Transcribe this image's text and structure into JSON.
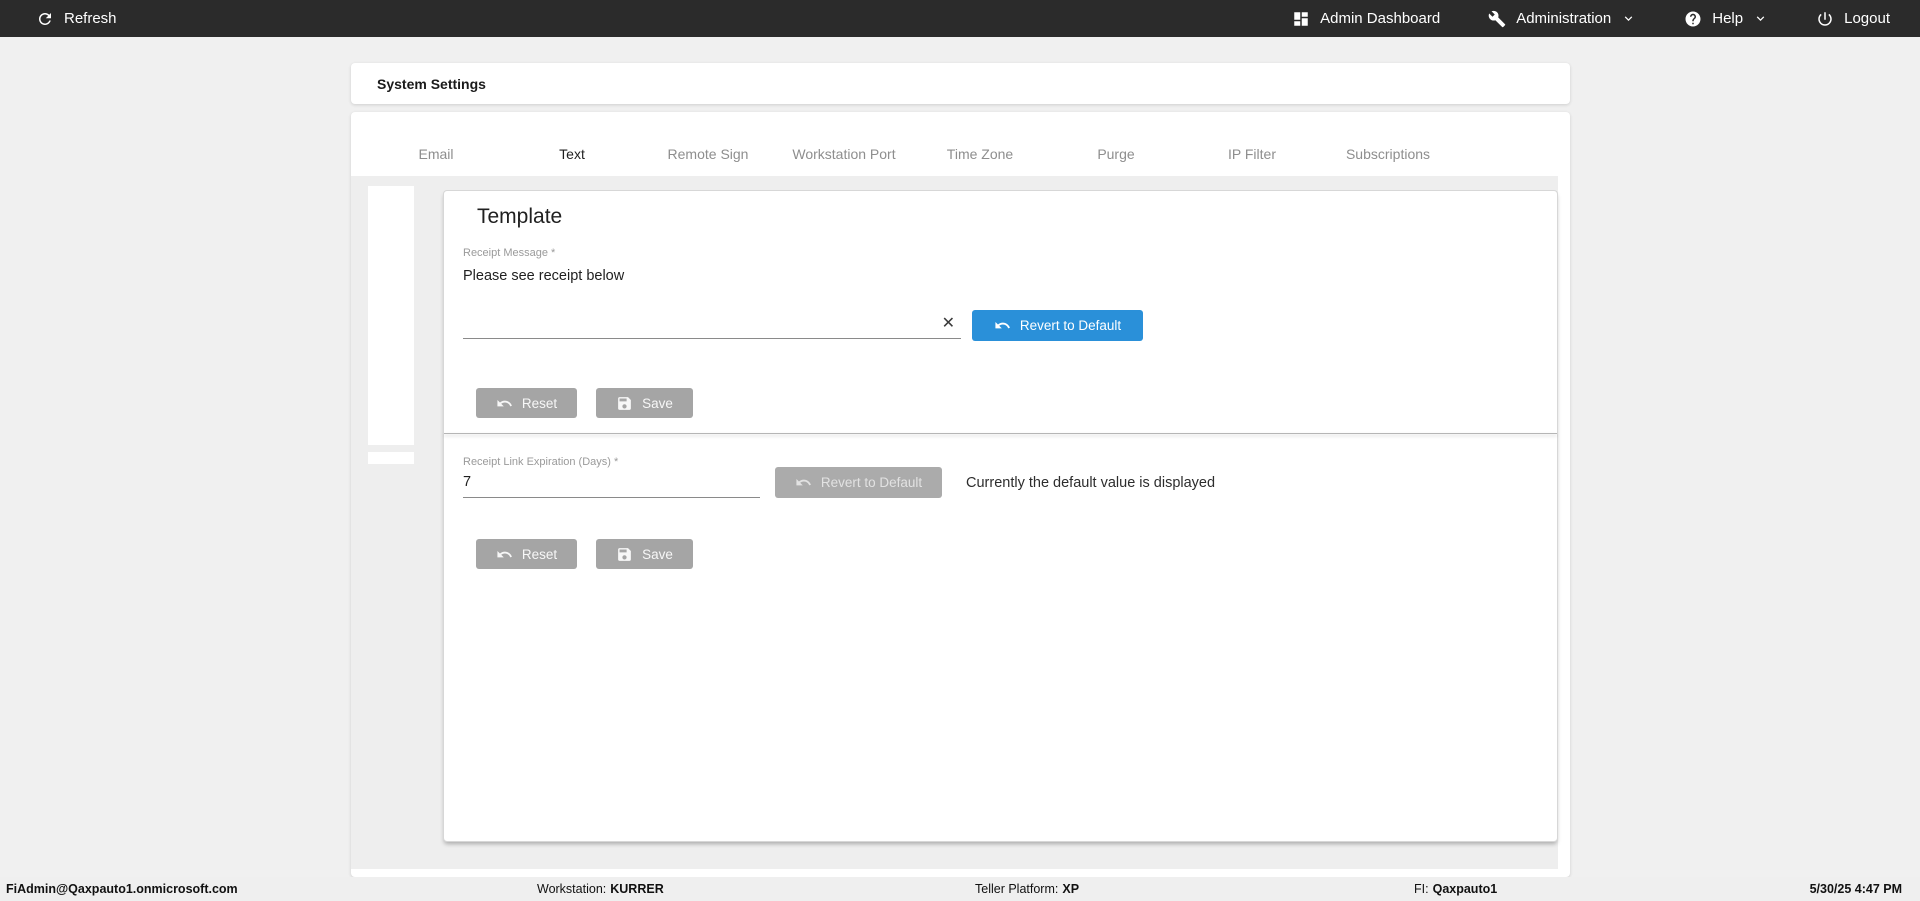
{
  "topbar": {
    "refresh_label": "Refresh",
    "admin_dashboard_label": "Admin Dashboard",
    "administration_label": "Administration",
    "help_label": "Help",
    "logout_label": "Logout"
  },
  "page": {
    "title": "System Settings"
  },
  "tabs": [
    {
      "label": "Email",
      "active": false
    },
    {
      "label": "Text",
      "active": true
    },
    {
      "label": "Remote Sign",
      "active": false
    },
    {
      "label": "Workstation Port",
      "active": false
    },
    {
      "label": "Time Zone",
      "active": false
    },
    {
      "label": "Purge",
      "active": false
    },
    {
      "label": "IP Filter",
      "active": false
    },
    {
      "label": "Subscriptions",
      "active": false
    }
  ],
  "template_section": {
    "heading": "Template",
    "receipt_message_label": "Receipt Message *",
    "receipt_message_value": "Please see receipt below",
    "clear_glyph": "✕",
    "revert_label": "Revert to Default",
    "reset_label": "Reset",
    "save_label": "Save"
  },
  "expiration_section": {
    "label": "Receipt Link Expiration (Days) *",
    "value": "7",
    "revert_label": "Revert to Default",
    "status_text": "Currently the default value is displayed",
    "reset_label": "Reset",
    "save_label": "Save"
  },
  "statusbar": {
    "user": "FiAdmin@Qaxpauto1.onmicrosoft.com",
    "workstation_label": "Workstation:",
    "workstation_value": "KURRER",
    "teller_platform_label": "Teller Platform:",
    "teller_platform_value": "XP",
    "fi_label": "FI:",
    "fi_value": "Qaxpauto1",
    "datetime": "5/30/25 4:47 PM"
  },
  "icons": {
    "refresh": "refresh-icon",
    "dashboard": "dashboard-grid-icon",
    "administration": "wrench-icon",
    "help": "question-circle-icon",
    "logout": "power-icon",
    "revert": "undo-icon",
    "save": "floppy-disk-icon",
    "clear": "close-icon",
    "dropdown": "chevron-down-icon"
  },
  "colors": {
    "topbar_bg": "#2b2b2b",
    "page_bg": "#f0f0f0",
    "accent_blue": "#2a90d9",
    "tab_ink_bar": "#3f51b5",
    "disabled_gray": "#ababab",
    "button_gray": "#a5a5a5"
  }
}
